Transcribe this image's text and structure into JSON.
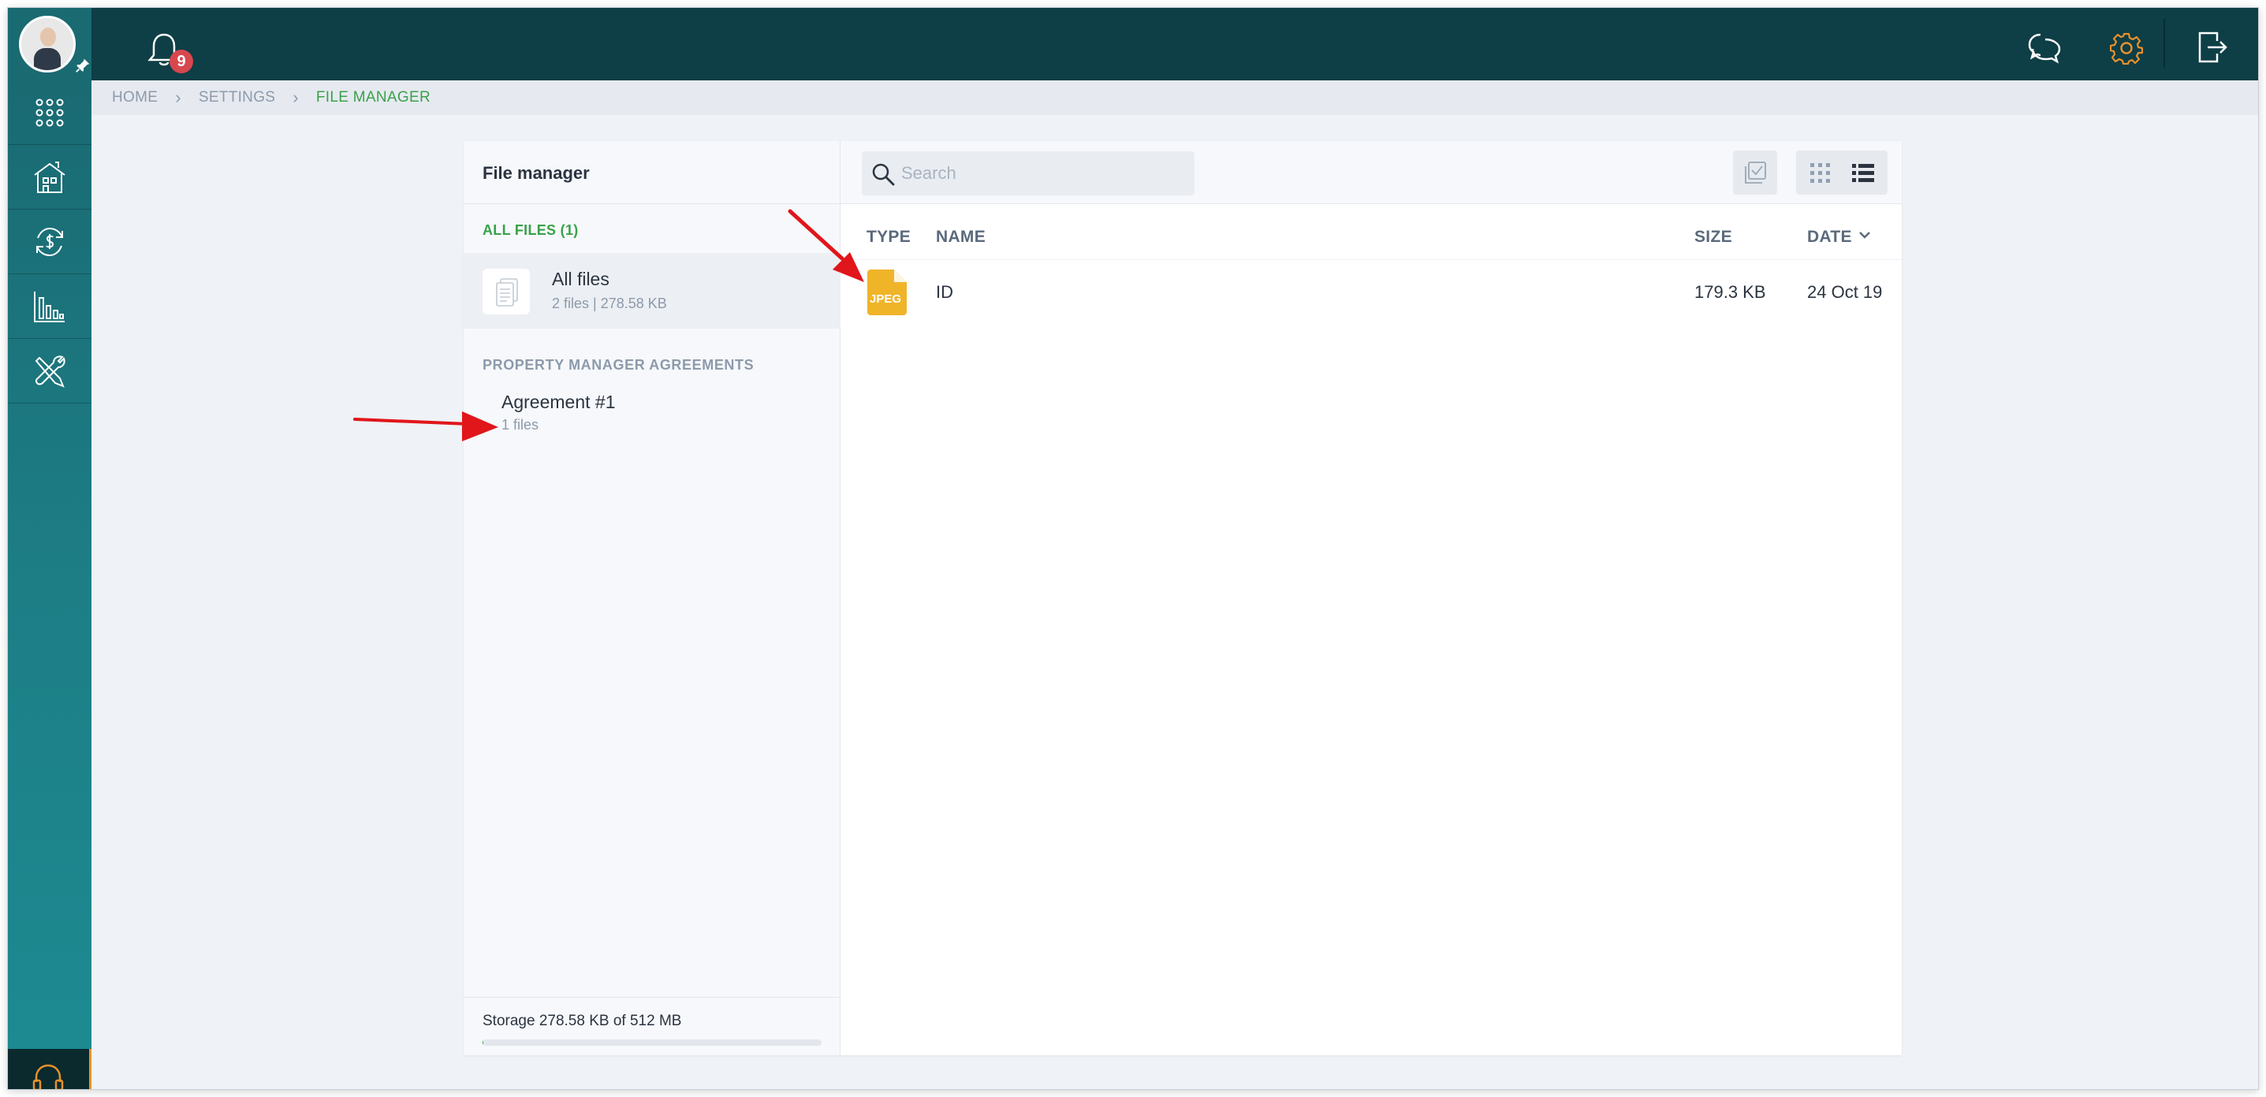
{
  "notifications": {
    "count": "9"
  },
  "breadcrumb": {
    "items": [
      "HOME",
      "SETTINGS",
      "FILE MANAGER"
    ]
  },
  "file_manager": {
    "title": "File manager",
    "all_files_header": "ALL FILES (1)",
    "all_files_item": {
      "name": "All files",
      "meta": "2 files | 278.58 KB"
    },
    "agreements_header": "PROPERTY MANAGER AGREEMENTS",
    "agreement_item": {
      "name": "Agreement #1",
      "meta": "1 files"
    },
    "storage": {
      "text": "Storage 278.58 KB of 512 MB",
      "used_fraction": 0.0005
    }
  },
  "search": {
    "placeholder": "Search"
  },
  "table": {
    "headers": {
      "type": "TYPE",
      "name": "NAME",
      "size": "SIZE",
      "date": "DATE"
    },
    "rows": [
      {
        "type_label": "JPEG",
        "name": "ID",
        "size": "179.3 KB",
        "date": "24 Oct 19"
      }
    ]
  },
  "colors": {
    "topbar": "#0e3e46",
    "sidebar": "#1a6a72",
    "accent_green": "#3aa14a",
    "badge_red": "#d7474e",
    "file_jpeg": "#f0b429",
    "gear_orange": "#e8912b",
    "arrow_red": "#e0161b"
  },
  "icons": {
    "topbar": [
      "avatar",
      "pin-icon",
      "bell-icon",
      "chat-icon",
      "gear-icon",
      "logout-icon"
    ],
    "sidebar": [
      "apps-grid-icon",
      "property-icon",
      "finance-icon",
      "reports-icon",
      "tools-icon",
      "headset-icon"
    ]
  }
}
